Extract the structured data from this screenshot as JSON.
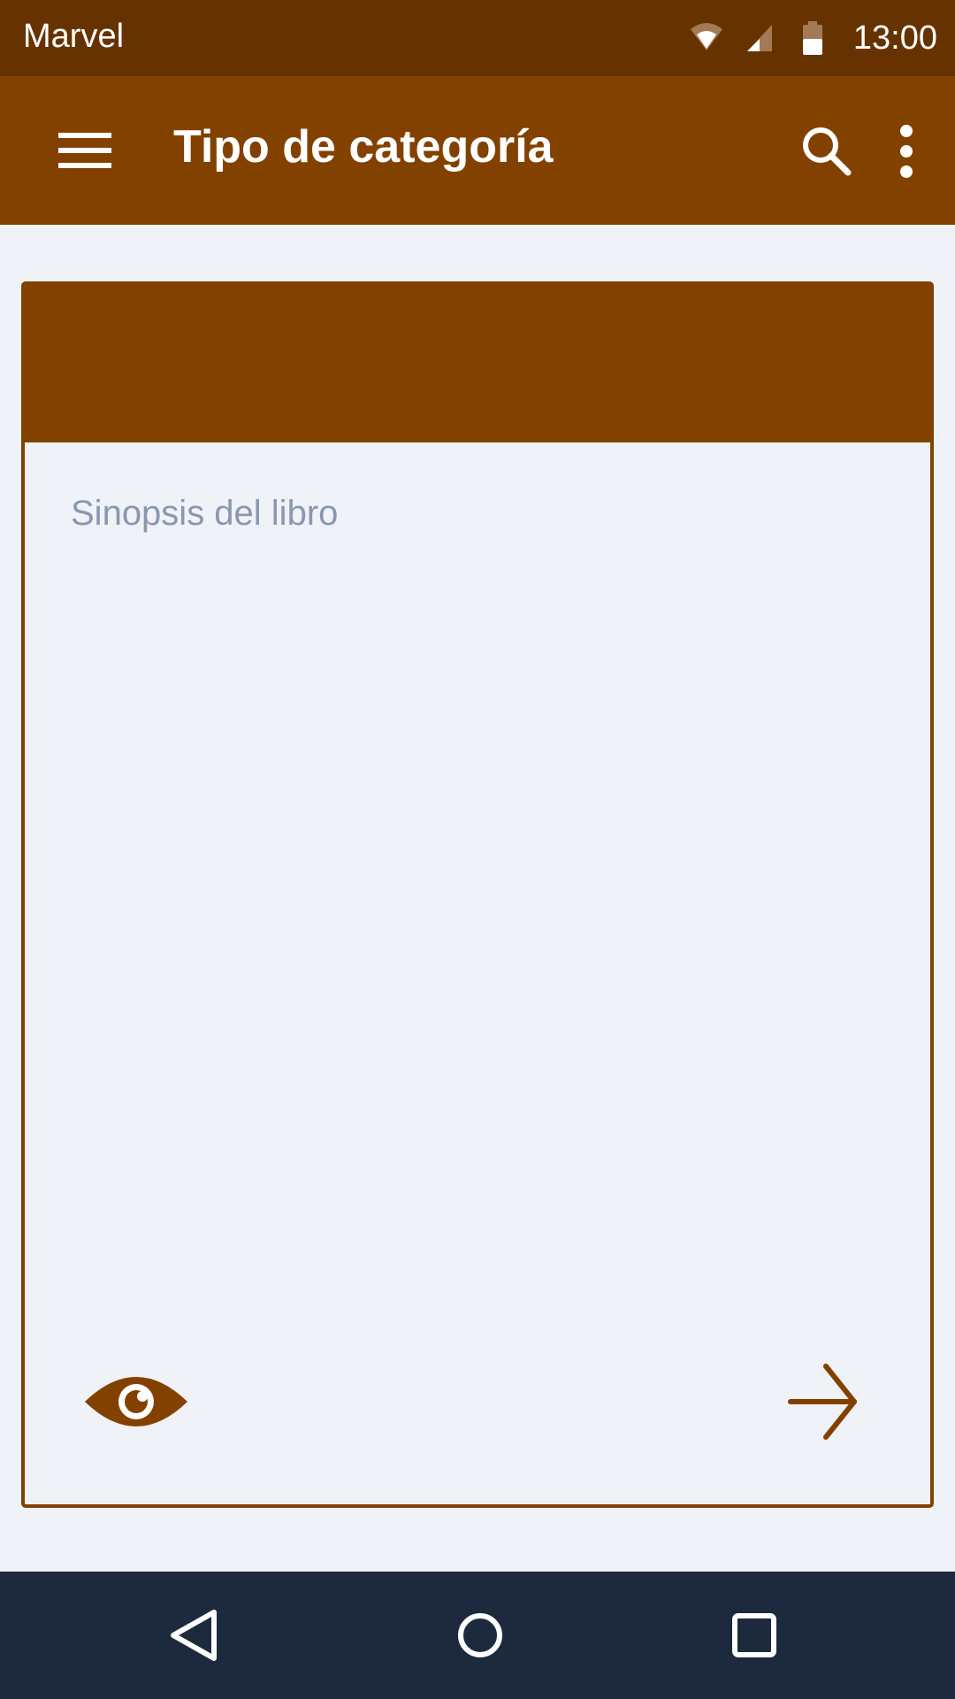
{
  "status_bar": {
    "carrier": "Marvel",
    "time": "13:00",
    "icons": [
      "wifi-icon",
      "signal-icon",
      "battery-icon"
    ]
  },
  "app_bar": {
    "title": "Tipo de categoría",
    "icons": [
      "menu-icon",
      "search-icon",
      "more-vert-icon"
    ]
  },
  "card": {
    "synopsis_placeholder": "Sinopsis del libro",
    "icons": [
      "eye-icon",
      "arrow-right-icon"
    ]
  },
  "nav_bar": {
    "icons": [
      "back-icon",
      "home-icon",
      "recents-icon"
    ]
  },
  "colors": {
    "status_bar": "#663300",
    "primary": "#834100",
    "background": "#eff2f7",
    "placeholder_text": "#8a97b0",
    "nav_bar": "#1d2a3d"
  }
}
